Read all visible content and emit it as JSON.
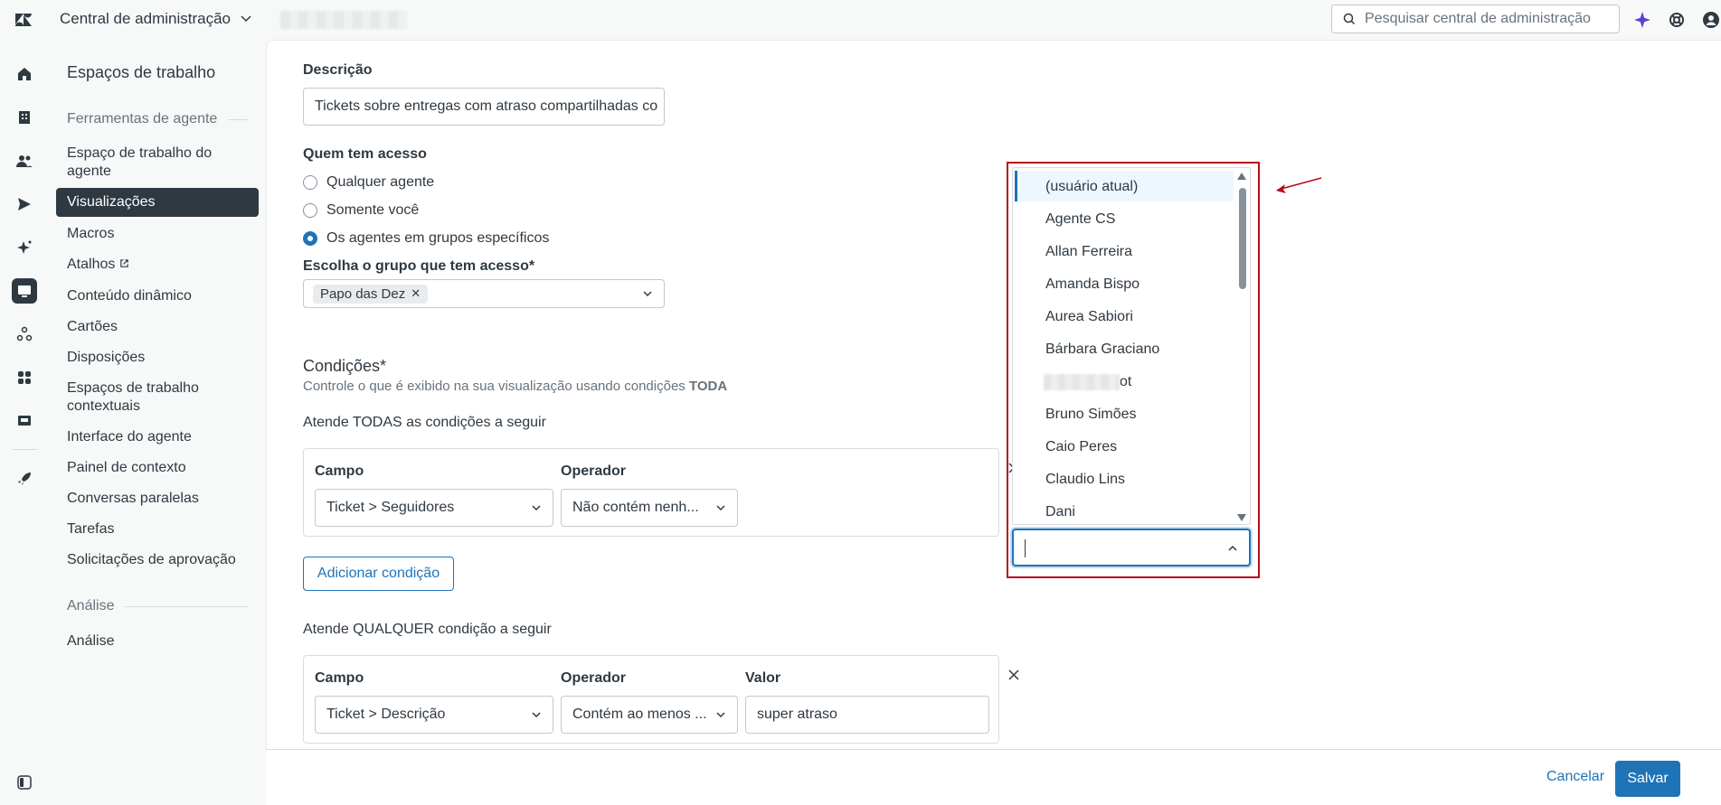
{
  "topbar": {
    "app_title": "Central de administração",
    "search_placeholder": "Pesquisar central de administração"
  },
  "sidenav": {
    "title": "Espaços de trabalho",
    "section_agent_tools": "Ferramentas de agente",
    "items": [
      "Espaço de trabalho do agente",
      "Visualizações",
      "Macros",
      "Atalhos",
      "Conteúdo dinâmico",
      "Cartões",
      "Disposições",
      "Espaços de trabalho contextuais",
      "Interface do agente",
      "Painel de contexto",
      "Conversas paralelas",
      "Tarefas",
      "Solicitações de aprovação"
    ],
    "section_analysis": "Análise",
    "analysis_items": [
      "Análise"
    ]
  },
  "form": {
    "description_label": "Descrição",
    "description_value": "Tickets sobre entregas com atraso compartilhadas co",
    "access_label": "Quem tem acesso",
    "access_options": [
      "Qualquer agente",
      "Somente você",
      "Os agentes em grupos específicos"
    ],
    "access_selected_index": 2,
    "group_label": "Escolha o grupo que tem acesso*",
    "group_tag": "Papo das Dez",
    "conditions_title": "Condições*",
    "conditions_hint": "Controle o que é exibido na sua visualização usando condições",
    "conditions_hint_bold": "TODA",
    "all_title": "Atende TODAS as condições a seguir",
    "any_title": "Atende QUALQUER condição a seguir",
    "col_field": "Campo",
    "col_operator": "Operador",
    "col_value": "Valor",
    "all_row": {
      "field": "Ticket > Seguidores",
      "operator": "Não contém nenh..."
    },
    "any_row": {
      "field": "Ticket > Descrição",
      "operator": "Contém ao menos ...",
      "value": "super atraso"
    },
    "add_condition": "Adicionar condição"
  },
  "dropdown": {
    "options": [
      "(usuário atual)",
      "Agente CS",
      "Allan Ferreira",
      "Amanda Bispo",
      "Aurea Sabiori",
      "Bárbara Graciano",
      "ot",
      "Bruno Simões",
      "Caio Peres",
      "Claudio Lins",
      "Dani"
    ]
  },
  "footer": {
    "cancel": "Cancelar",
    "save": "Salvar"
  },
  "colors": {
    "accent": "#1f73b7",
    "highlight": "#b80a1a",
    "dark": "#2f3941"
  }
}
